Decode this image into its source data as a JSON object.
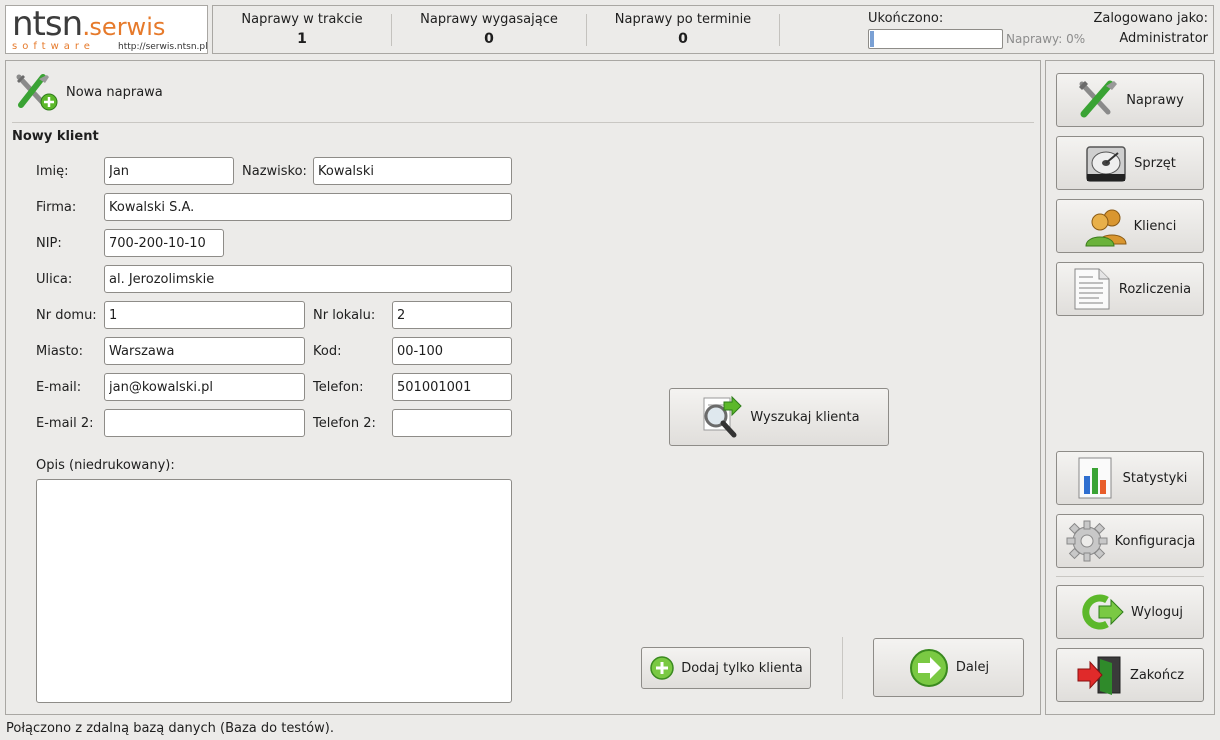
{
  "logo": {
    "main": "ntsn",
    "serwis": "serwis",
    "soft": "software",
    "url": "http://serwis.ntsn.pl"
  },
  "header": {
    "stats": [
      {
        "label": "Naprawy w trakcie",
        "value": "1"
      },
      {
        "label": "Naprawy wygasające",
        "value": "0"
      },
      {
        "label": "Naprawy po terminie",
        "value": "0"
      }
    ],
    "progress_label": "Ukończono:",
    "progress_value": 0,
    "progress_text": "Naprawy: 0%",
    "login_label": "Zalogowano jako:",
    "login_user": "Administrator"
  },
  "page": {
    "title": "Nowa naprawa",
    "section": "Nowy klient"
  },
  "form": {
    "imie_label": "Imię:",
    "imie": "Jan",
    "nazwisko_label": "Nazwisko:",
    "nazwisko": "Kowalski",
    "firma_label": "Firma:",
    "firma": "Kowalski S.A.",
    "nip_label": "NIP:",
    "nip": "700-200-10-10",
    "ulica_label": "Ulica:",
    "ulica": "al. Jerozolimskie",
    "nr_domu_label": "Nr domu:",
    "nr_domu": "1",
    "nr_lokalu_label": "Nr lokalu:",
    "nr_lokalu": "2",
    "miasto_label": "Miasto:",
    "miasto": "Warszawa",
    "kod_label": "Kod:",
    "kod": "00-100",
    "email_label": "E-mail:",
    "email": "jan@kowalski.pl",
    "telefon_label": "Telefon:",
    "telefon": "501001001",
    "email2_label": "E-mail 2:",
    "email2": "",
    "telefon2_label": "Telefon 2:",
    "telefon2": "",
    "opis_label": "Opis (niedrukowany):",
    "opis": ""
  },
  "buttons": {
    "search": "Wyszukaj klienta",
    "add_client": "Dodaj tylko klienta",
    "next": "Dalej"
  },
  "sidebar": {
    "items": [
      {
        "label": "Naprawy",
        "icon": "tools-icon"
      },
      {
        "label": "Sprzęt",
        "icon": "hard-drive-icon"
      },
      {
        "label": "Klienci",
        "icon": "users-icon"
      },
      {
        "label": "Rozliczenia",
        "icon": "document-icon"
      },
      {
        "label": "Statystyki",
        "icon": "chart-icon"
      },
      {
        "label": "Konfiguracja",
        "icon": "gear-icon"
      },
      {
        "label": "Wyloguj",
        "icon": "logout-icon"
      },
      {
        "label": "Zakończ",
        "icon": "exit-icon"
      }
    ]
  },
  "colors": {
    "accent_orange": "#e67a2b",
    "green": "#5cb82a",
    "progress": "#7aa0d4"
  },
  "status_bar": "Połączono z zdalną bazą danych (Baza do testów)."
}
